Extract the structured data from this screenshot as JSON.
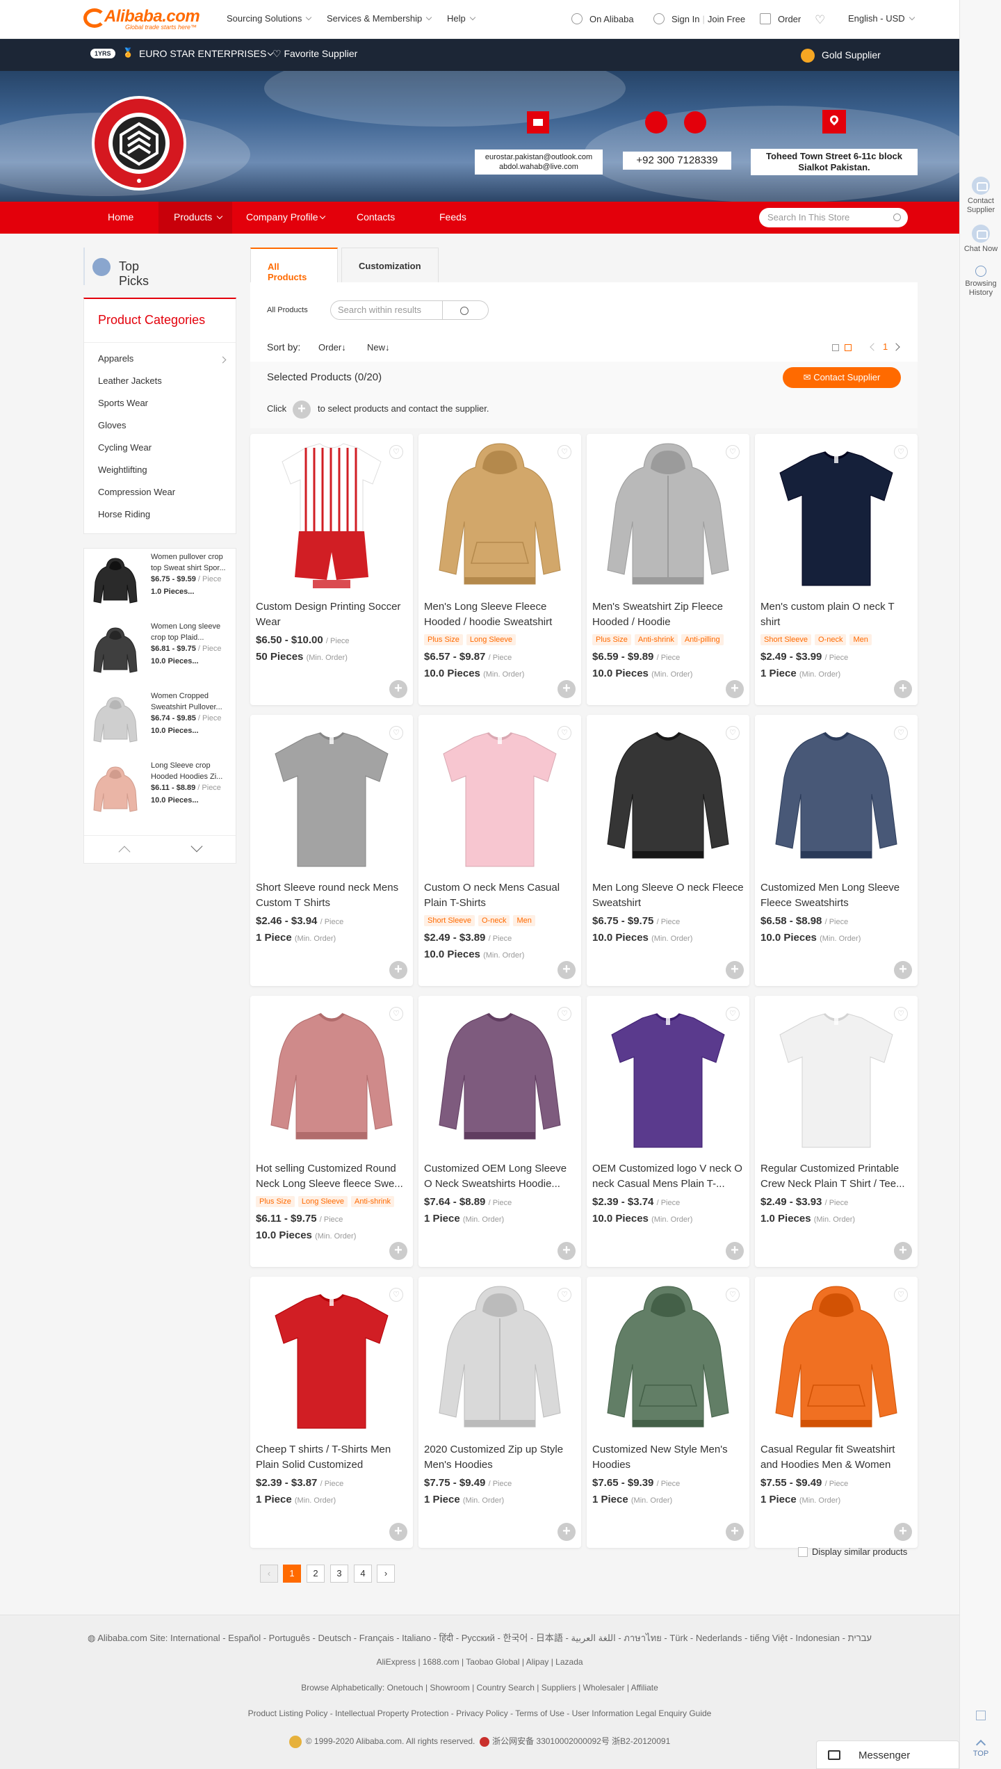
{
  "topnav": {
    "logo": "Alibaba.com",
    "logo_sub": "Global trade starts here™",
    "sourcing": "Sourcing Solutions",
    "services": "Services & Membership",
    "help": "Help",
    "on_alibaba": "On Alibaba",
    "sign_in": "Sign In",
    "join_free": "Join Free",
    "order": "Order",
    "lang": "English - USD"
  },
  "right_rail": {
    "contact": "Contact Supplier",
    "chat": "Chat Now",
    "history": "Browsing History",
    "top": "TOP"
  },
  "store": {
    "years": "1YRS",
    "name": "EURO STAR ENTERPRISES",
    "favorite": "Favorite Supplier",
    "gold": "Gold Supplier",
    "logo_text": "EURO STAR ENTERPRISES",
    "email": "eurostar.pakistan@outlook.com",
    "email2": "abdol.wahab@live.com",
    "phone": "+92 300 7128339",
    "address": "Toheed Town Street 6-11c block Sialkot Pakistan."
  },
  "storenav": {
    "home": "Home",
    "products": "Products",
    "profile": "Company Profile",
    "contacts": "Contacts",
    "feeds": "Feeds",
    "search_placeholder": "Search In This Store"
  },
  "sidebar": {
    "top_picks": "Top Picks",
    "categories_title": "Product Categories",
    "categories": [
      "Apparels",
      "Leather Jackets",
      "Sports Wear",
      "Gloves",
      "Cycling Wear",
      "Weightlifting",
      "Compression Wear",
      "Horse Riding"
    ],
    "mini_products": [
      {
        "title": "Women pullover crop top Sweat shirt Spor...",
        "price": "$6.75 - $9.59",
        "unit": "/ Piece",
        "moq": "1.0 Pieces..."
      },
      {
        "title": "Women Long sleeve crop top Plaid...",
        "price": "$6.81 - $9.75",
        "unit": "/ Piece",
        "moq": "10.0 Pieces..."
      },
      {
        "title": "Women Cropped Sweatshirt Pullover...",
        "price": "$6.74 - $9.85",
        "unit": "/ Piece",
        "moq": "10.0 Pieces..."
      },
      {
        "title": "Long Sleeve crop Hooded Hoodies Zi...",
        "price": "$6.11 - $8.89",
        "unit": "/ Piece",
        "moq": "10.0 Pieces..."
      }
    ]
  },
  "main": {
    "tab_all": "All Products",
    "tab_custom": "Customization",
    "crumb": "All Products",
    "search_placeholder": "Search within results",
    "sort_by": "Sort by:",
    "sort_order": "Order↓",
    "sort_new": "New↓",
    "page_indicator": "1",
    "selected": "Selected Products (0/20)",
    "contact_btn": "Contact Supplier",
    "click": "Click",
    "click_hint": "to select products and contact the supplier.",
    "similar": "Display similar products",
    "pages": [
      "1",
      "2",
      "3",
      "4"
    ]
  },
  "products": [
    {
      "title": "Custom Design Printing Soccer Wear",
      "tags": [],
      "price": "$6.50 - $10.00",
      "unit": "/ Piece",
      "moq": "50 Pieces",
      "moq_note": "(Min. Order)"
    },
    {
      "title": "Men's Long Sleeve Fleece Hooded / hoodie Sweatshirt",
      "tags": [
        "Plus Size",
        "Long Sleeve"
      ],
      "price": "$6.57 - $9.87",
      "unit": "/ Piece",
      "moq": "10.0 Pieces",
      "moq_note": "(Min. Order)"
    },
    {
      "title": "Men's Sweatshirt Zip Fleece Hooded / Hoodie",
      "tags": [
        "Plus Size",
        "Anti-shrink",
        "Anti-pilling"
      ],
      "price": "$6.59 - $9.89",
      "unit": "/ Piece",
      "moq": "10.0 Pieces",
      "moq_note": "(Min. Order)"
    },
    {
      "title": "Men's custom plain O neck T shirt",
      "tags": [
        "Short Sleeve",
        "O-neck",
        "Men"
      ],
      "price": "$2.49 - $3.99",
      "unit": "/ Piece",
      "moq": "1 Piece",
      "moq_note": "(Min. Order)"
    },
    {
      "title": "Short Sleeve round neck Mens Custom T Shirts",
      "tags": [],
      "price": "$2.46 - $3.94",
      "unit": "/ Piece",
      "moq": "1 Piece",
      "moq_note": "(Min. Order)"
    },
    {
      "title": "Custom O neck Mens Casual Plain T-Shirts",
      "tags": [
        "Short Sleeve",
        "O-neck",
        "Men"
      ],
      "price": "$2.49 - $3.89",
      "unit": "/ Piece",
      "moq": "10.0 Pieces",
      "moq_note": "(Min. Order)"
    },
    {
      "title": "Men Long Sleeve O neck Fleece Sweatshirt",
      "tags": [],
      "price": "$6.75 - $9.75",
      "unit": "/ Piece",
      "moq": "10.0 Pieces",
      "moq_note": "(Min. Order)"
    },
    {
      "title": "Customized Men Long Sleeve Fleece Sweatshirts",
      "tags": [],
      "price": "$6.58 - $8.98",
      "unit": "/ Piece",
      "moq": "10.0 Pieces",
      "moq_note": "(Min. Order)"
    },
    {
      "title": "Hot selling Customized Round Neck Long Sleeve fleece Swe...",
      "tags": [
        "Plus Size",
        "Long Sleeve",
        "Anti-shrink"
      ],
      "price": "$6.11 - $9.75",
      "unit": "/ Piece",
      "moq": "10.0 Pieces",
      "moq_note": "(Min. Order)"
    },
    {
      "title": "Customized OEM Long Sleeve O Neck Sweatshirts Hoodie...",
      "tags": [],
      "price": "$7.64 - $8.89",
      "unit": "/ Piece",
      "moq": "1 Piece",
      "moq_note": "(Min. Order)"
    },
    {
      "title": "OEM Customized logo V neck O neck Casual Mens Plain T-...",
      "tags": [],
      "price": "$2.39 - $3.74",
      "unit": "/ Piece",
      "moq": "10.0 Pieces",
      "moq_note": "(Min. Order)"
    },
    {
      "title": "Regular Customized Printable Crew Neck Plain T Shirt / Tee...",
      "tags": [],
      "price": "$2.49 - $3.93",
      "unit": "/ Piece",
      "moq": "1.0 Pieces",
      "moq_note": "(Min. Order)"
    },
    {
      "title": "Cheep T shirts / T-Shirts Men Plain Solid Customized",
      "tags": [],
      "price": "$2.39 - $3.87",
      "unit": "/ Piece",
      "moq": "1 Piece",
      "moq_note": "(Min. Order)"
    },
    {
      "title": "2020 Customized Zip up Style Men's Hoodies",
      "tags": [],
      "price": "$7.75 - $9.49",
      "unit": "/ Piece",
      "moq": "1 Piece",
      "moq_note": "(Min. Order)"
    },
    {
      "title": "Customized New Style Men's Hoodies",
      "tags": [],
      "price": "$7.65 - $9.39",
      "unit": "/ Piece",
      "moq": "1 Piece",
      "moq_note": "(Min. Order)"
    },
    {
      "title": "Casual Regular fit Sweatshirt and Hoodies Men & Women",
      "tags": [],
      "price": "$7.55 - $9.49",
      "unit": "/ Piece",
      "moq": "1 Piece",
      "moq_note": "(Min. Order)"
    }
  ],
  "product_visuals": [
    {
      "kind": "soccer",
      "color": "#ffffff"
    },
    {
      "kind": "hoodie",
      "color": "#d2a76a"
    },
    {
      "kind": "zip",
      "color": "#b9b9b9"
    },
    {
      "kind": "tee",
      "color": "#15203a"
    },
    {
      "kind": "tee",
      "color": "#a3a3a3"
    },
    {
      "kind": "tee",
      "color": "#f7c6d0"
    },
    {
      "kind": "sweat",
      "color": "#353535"
    },
    {
      "kind": "sweat",
      "color": "#485877"
    },
    {
      "kind": "sweat",
      "color": "#cf8a8a"
    },
    {
      "kind": "sweat",
      "color": "#7e5b7e"
    },
    {
      "kind": "tee",
      "color": "#5a3a8d"
    },
    {
      "kind": "tee",
      "color": "#f1f1f1"
    },
    {
      "kind": "tee",
      "color": "#d11e24"
    },
    {
      "kind": "zip",
      "color": "#d9d9d9"
    },
    {
      "kind": "hoodie",
      "color": "#627e66"
    },
    {
      "kind": "hoodie",
      "color": "#f07022"
    }
  ],
  "mini_visuals": [
    "#2a2a2a",
    "#3f3f3f",
    "#cfcfcf",
    "#eab5a6"
  ],
  "footer": {
    "sites_label": "Alibaba.com Site:",
    "sites": "International - Español - Português - Deutsch - Français - Italiano - हिंदी - Русский - 한국어 - 日本語 - اللغة العربية - ภาษาไทย - Türk - Nederlands - tiếng Việt - Indonesian - עברית",
    "group": "AliExpress | 1688.com | Taobao Global | Alipay | Lazada",
    "browse": "Browse Alphabetically: Onetouch | Showroom | Country Search | Suppliers | Wholesaler | Affiliate",
    "policy": "Product Listing Policy - Intellectual Property Protection - Privacy Policy - Terms of Use - User Information Legal Enquiry Guide",
    "copyright": "© 1999-2020 Alibaba.com. All rights reserved.",
    "license": "浙公网安备 33010002000092号   浙B2-20120091"
  },
  "messenger": "Messenger",
  "colors": {
    "accent": "#ff6a00",
    "store_red": "#e3000b",
    "store_dark": "#1c2636"
  }
}
